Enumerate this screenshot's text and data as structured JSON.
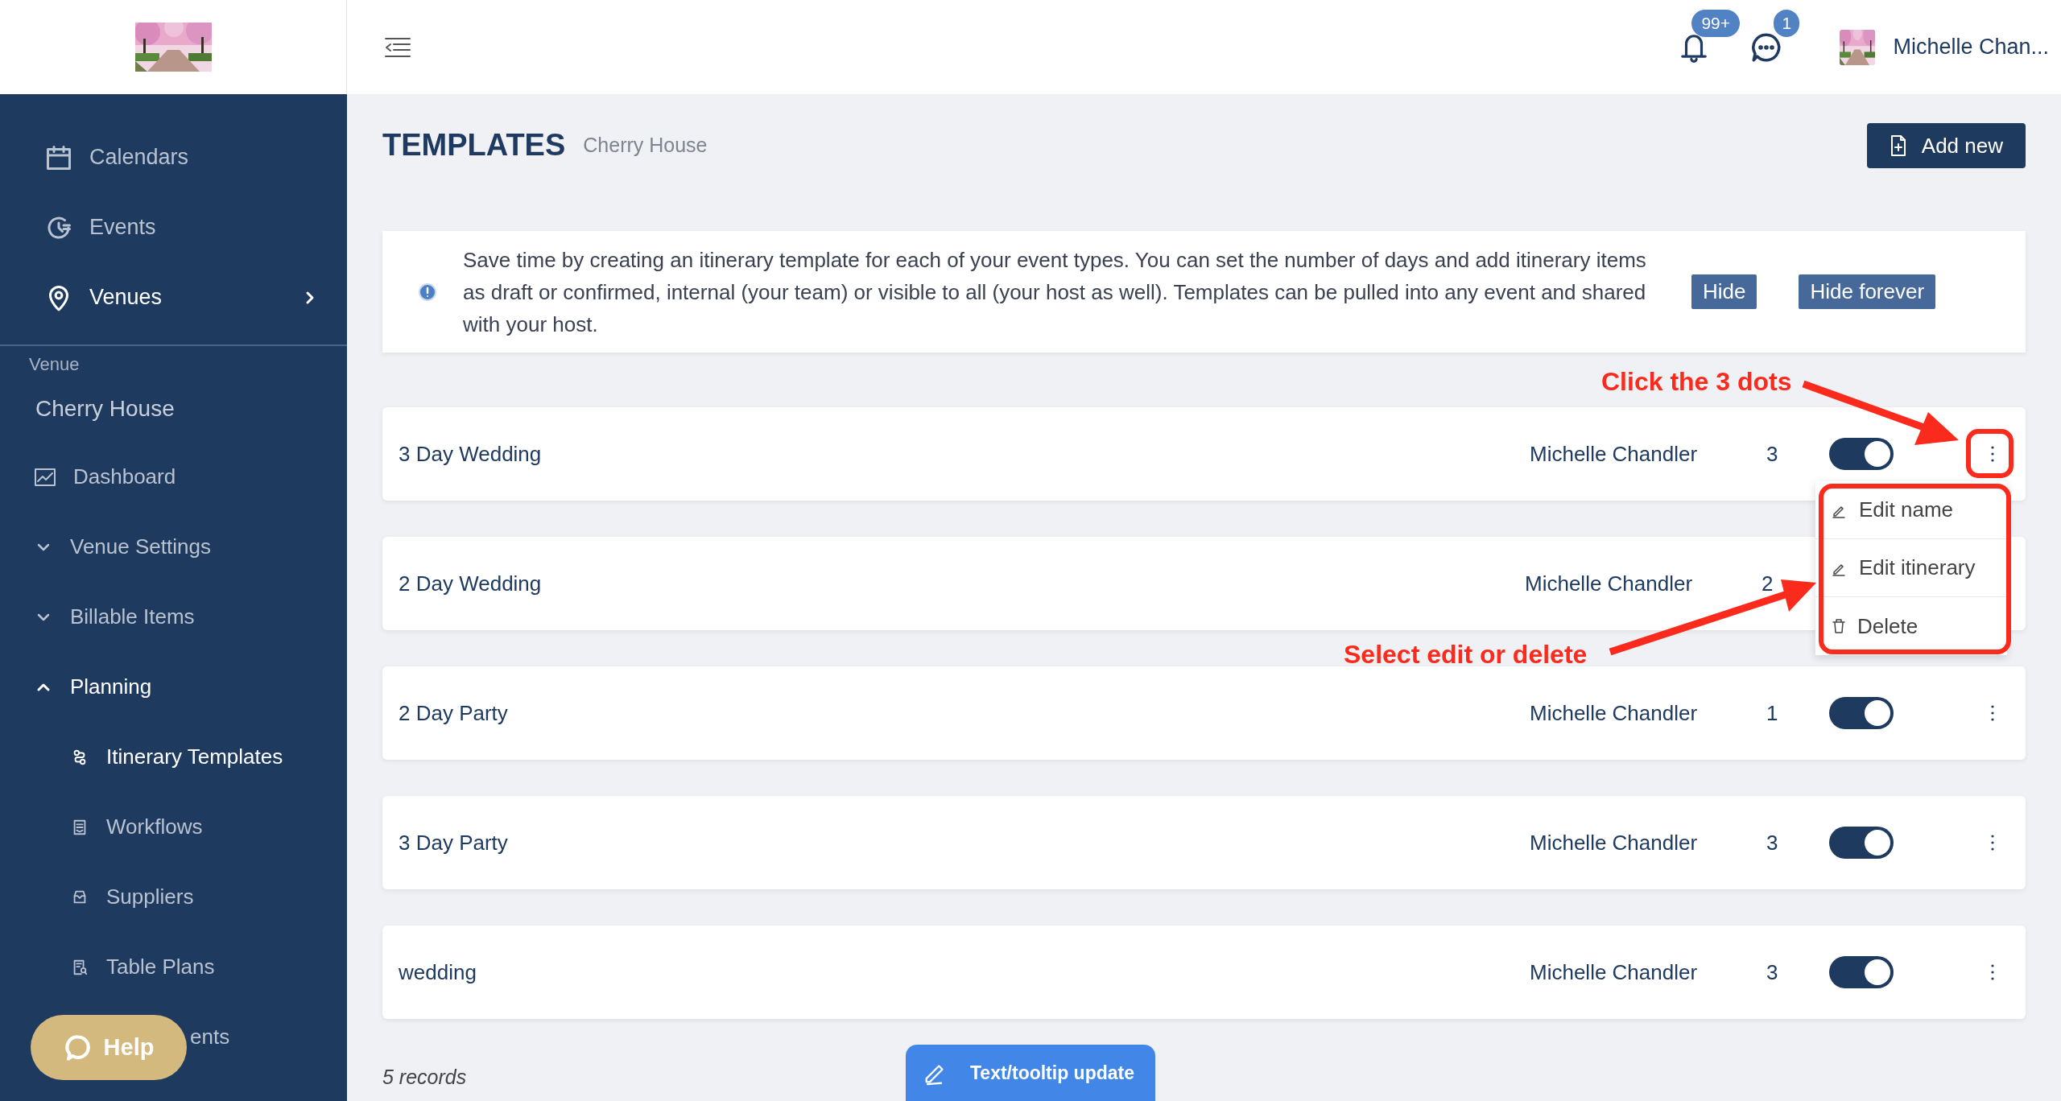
{
  "header": {
    "notifications": {
      "badge": "99+"
    },
    "messages": {
      "badge": "1"
    },
    "user": {
      "name": "Michelle Chan..."
    }
  },
  "sidebar": {
    "nav": [
      {
        "label": "Calendars",
        "selected": false
      },
      {
        "label": "Events",
        "selected": false
      },
      {
        "label": "Venues",
        "selected": true
      }
    ],
    "venue": {
      "heading": "Venue",
      "name": "Cherry House",
      "items": [
        {
          "label": "Dashboard",
          "kind": "link"
        },
        {
          "label": "Venue Settings",
          "kind": "group",
          "expanded": false
        },
        {
          "label": "Billable Items",
          "kind": "group",
          "expanded": false
        },
        {
          "label": "Planning",
          "kind": "group",
          "expanded": true,
          "children": [
            {
              "label": "Itinerary Templates",
              "selected": true
            },
            {
              "label": "Workflows",
              "selected": false
            },
            {
              "label": "Suppliers",
              "selected": false
            },
            {
              "label": "Table Plans",
              "selected": false
            },
            {
              "label": "ents",
              "selected": false
            }
          ]
        }
      ]
    }
  },
  "page": {
    "title": "TEMPLATES",
    "subtitle": "Cherry House",
    "add_button": "Add new"
  },
  "notice": {
    "text": "Save time by creating an itinerary template for each of your event types. You can set the number of days and add itinerary items as draft or confirmed, internal (your team) or visible to all (your host as well). Templates can be pulled into any event and shared with your host.",
    "buttons": [
      "Hide",
      "Hide forever"
    ]
  },
  "templates": [
    {
      "name": "3 Day Wedding",
      "owner": "Michelle Chandler",
      "days": "3",
      "on": true,
      "menu": [
        {
          "label": "Edit name",
          "kind": "edit"
        },
        {
          "label": "Edit itinerary",
          "kind": "edit"
        },
        {
          "label": "Delete",
          "kind": "delete"
        }
      ]
    },
    {
      "name": "2 Day Wedding",
      "owner": "Michelle Chandler",
      "days": "2"
    },
    {
      "name": "2 Day Party",
      "owner": "Michelle Chandler",
      "days": "1",
      "on": true
    },
    {
      "name": "3 Day Party",
      "owner": "Michelle Chandler",
      "days": "3",
      "on": true
    },
    {
      "name": "wedding",
      "owner": "Michelle Chandler",
      "days": "3",
      "on": true
    }
  ],
  "annotations": [
    {
      "text": "Click the 3 dots"
    },
    {
      "text": "Select edit or delete"
    }
  ],
  "footer": {
    "records": "5 records"
  },
  "help_button": "Help",
  "feedback_button": "Text/tooltip update"
}
